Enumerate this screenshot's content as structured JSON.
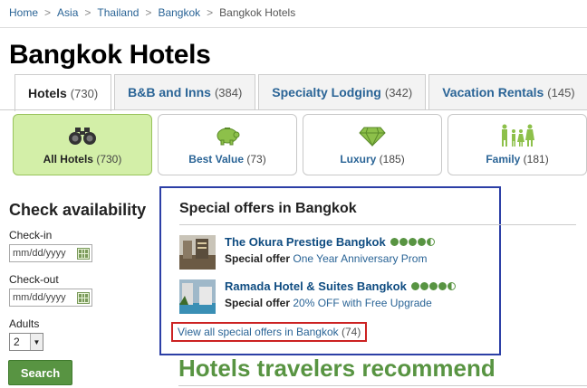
{
  "breadcrumb": [
    "Home",
    "Asia",
    "Thailand",
    "Bangkok"
  ],
  "breadcrumb_current": "Bangkok Hotels",
  "breadcrumb_sep": ">",
  "page_title": "Bangkok Hotels",
  "tabs": [
    {
      "label": "Hotels",
      "count": "(730)"
    },
    {
      "label": "B&B and Inns",
      "count": "(384)"
    },
    {
      "label": "Specialty Lodging",
      "count": "(342)"
    },
    {
      "label": "Vacation Rentals",
      "count": "(145)"
    }
  ],
  "categories": [
    {
      "label": "All Hotels",
      "count": "(730)",
      "icon": "binoculars-icon"
    },
    {
      "label": "Best Value",
      "count": "(73)",
      "icon": "piggy-bank-icon"
    },
    {
      "label": "Luxury",
      "count": "(185)",
      "icon": "diamond-icon"
    },
    {
      "label": "Family",
      "count": "(181)",
      "icon": "family-icon"
    }
  ],
  "check": {
    "title": "Check availability",
    "checkin_label": "Check-in",
    "checkin_placeholder": "mm/dd/yyyy",
    "checkout_label": "Check-out",
    "checkout_placeholder": "mm/dd/yyyy",
    "adults_label": "Adults",
    "adults_value": "2",
    "search_label": "Search"
  },
  "offers": {
    "title": "Special offers in Bangkok",
    "items": [
      {
        "name": "The Okura Prestige Bangkok",
        "offer_label": "Special offer",
        "offer_text": "One Year Anniversary Prom",
        "rating": 4.5
      },
      {
        "name": "Ramada Hotel & Suites Bangkok",
        "offer_label": "Special offer",
        "offer_text": "20% OFF with Free Upgrade",
        "rating": 4.5
      }
    ],
    "view_all_text": "View all special offers in Bangkok",
    "view_all_count": "(74)"
  },
  "recommend_title": "Hotels travelers recommend",
  "colors": {
    "brand_green": "#589442",
    "link_blue": "#2a6496",
    "offers_border": "#2c3fa6",
    "view_all_border": "#cc2222",
    "active_cat_bg": "#d3efa8"
  }
}
